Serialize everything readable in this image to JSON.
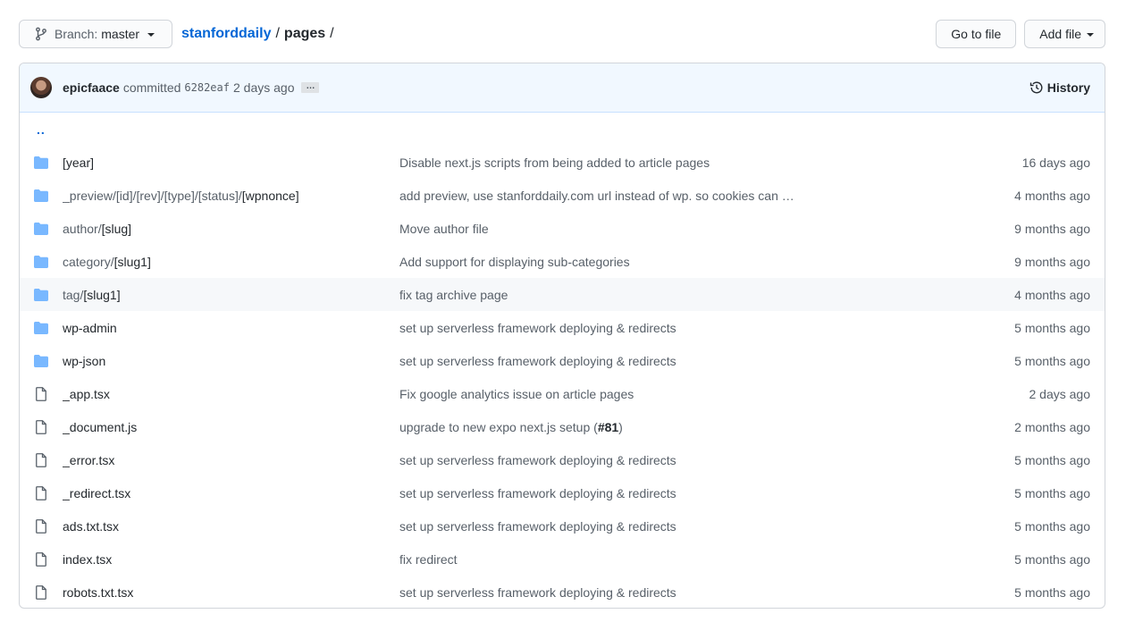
{
  "branch": {
    "label": "Branch:",
    "value": "master"
  },
  "breadcrumb": {
    "repo": "stanforddaily",
    "sep1": "/",
    "dir": "pages",
    "sep2": "/"
  },
  "actions": {
    "go_to_file": "Go to file",
    "add_file": "Add file"
  },
  "commit": {
    "author": "epicfaace",
    "verb": "committed",
    "sha": "6282eaf",
    "ago": "2 days ago",
    "ellipsis": "…",
    "history_label": "History"
  },
  "parent_dir": "..",
  "files": [
    {
      "type": "dir",
      "prefix": "",
      "name": "[year]",
      "message": "Disable next.js scripts from being added to article pages",
      "age": "16 days ago"
    },
    {
      "type": "dir",
      "prefix": "_preview/[id]/[rev]/[type]/[status]/",
      "name": "[wpnonce]",
      "message": "add preview, use stanforddaily.com url instead of wp. so cookies can …",
      "age": "4 months ago"
    },
    {
      "type": "dir",
      "prefix": "author/",
      "name": "[slug]",
      "message": "Move author file",
      "age": "9 months ago"
    },
    {
      "type": "dir",
      "prefix": "category/",
      "name": "[slug1]",
      "message": "Add support for displaying sub-categories",
      "age": "9 months ago"
    },
    {
      "type": "dir",
      "prefix": "tag/",
      "name": "[slug1]",
      "message": "fix tag archive page",
      "age": "4 months ago"
    },
    {
      "type": "dir",
      "prefix": "",
      "name": "wp-admin",
      "message": "set up serverless framework deploying & redirects",
      "age": "5 months ago"
    },
    {
      "type": "dir",
      "prefix": "",
      "name": "wp-json",
      "message": "set up serverless framework deploying & redirects",
      "age": "5 months ago"
    },
    {
      "type": "file",
      "prefix": "",
      "name": "_app.tsx",
      "message": "Fix google analytics issue on article pages",
      "age": "2 days ago"
    },
    {
      "type": "file",
      "prefix": "",
      "name": "_document.js",
      "message": "upgrade to new expo next.js setup (",
      "issue": "#81",
      "message_end": ")",
      "age": "2 months ago"
    },
    {
      "type": "file",
      "prefix": "",
      "name": "_error.tsx",
      "message": "set up serverless framework deploying & redirects",
      "age": "5 months ago"
    },
    {
      "type": "file",
      "prefix": "",
      "name": "_redirect.tsx",
      "message": "set up serverless framework deploying & redirects",
      "age": "5 months ago"
    },
    {
      "type": "file",
      "prefix": "",
      "name": "ads.txt.tsx",
      "message": "set up serverless framework deploying & redirects",
      "age": "5 months ago"
    },
    {
      "type": "file",
      "prefix": "",
      "name": "index.tsx",
      "message": "fix redirect",
      "age": "5 months ago"
    },
    {
      "type": "file",
      "prefix": "",
      "name": "robots.txt.tsx",
      "message": "set up serverless framework deploying & redirects",
      "age": "5 months ago"
    }
  ],
  "colors": {
    "link": "#0366d6",
    "folder": "#79b8ff",
    "muted": "#586069",
    "header_bg": "#f1f8ff",
    "row_highlight": "#f6f8fa"
  },
  "icons": {
    "branch": "git-branch-icon",
    "history": "history-icon",
    "dir": "folder-icon",
    "file": "file-icon"
  }
}
